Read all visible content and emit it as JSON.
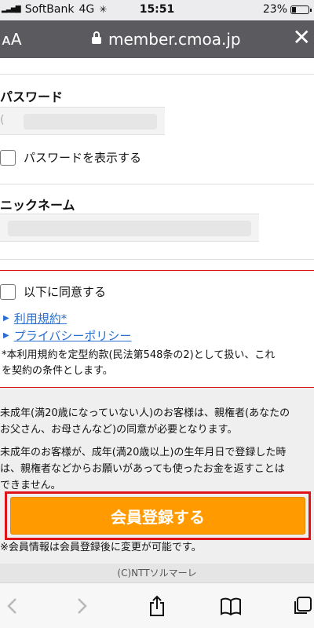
{
  "status_bar": {
    "carrier": "SoftBank",
    "network": "4G",
    "time": "15:51",
    "battery": "23%",
    "battery_fraction": 0.23
  },
  "browser": {
    "text_size_label": "ᴀA",
    "url": "member.cmoa.jp",
    "close_icon": "close-icon"
  },
  "form": {
    "password_label": "パスワード",
    "password_value": "(",
    "show_password_label": "パスワードを表示する",
    "nickname_label": "ニックネーム"
  },
  "agreement": {
    "agree_label": "以下に同意する",
    "terms_link": "利用規約*",
    "privacy_link": "プライバシーポリシー",
    "note_line1": "*本利用規約を定型約款(民法第548条の2)として扱い、これ",
    "note_line2": "を契約の条件とします。"
  },
  "notices": {
    "line1": "未成年(満20歳になっていない人)のお客様は、親権者(あなたの",
    "line2": "お父さん、お母さんなど)の同意が必要となります。",
    "line3": "未成年のお客様が、成年(満20歳以上)の生年月日で登録した時",
    "line4": "は、親権者などからお願いがあっても使ったお金を返すことは",
    "line5": "できません。"
  },
  "register_button": "会員登録する",
  "footer_note": "※会員情報は会員登録後に変更が可能です。",
  "copyright": "(C)NTTソルマーレ",
  "toolbar": {
    "icons": [
      "back-icon",
      "forward-icon",
      "share-icon",
      "bookmarks-icon",
      "tabs-icon"
    ]
  },
  "colors": {
    "accent_orange": "#ff9a00",
    "highlight_red": "#e0121a",
    "link_blue": "#2a6fd0",
    "address_bar": "#5b5b5f"
  }
}
